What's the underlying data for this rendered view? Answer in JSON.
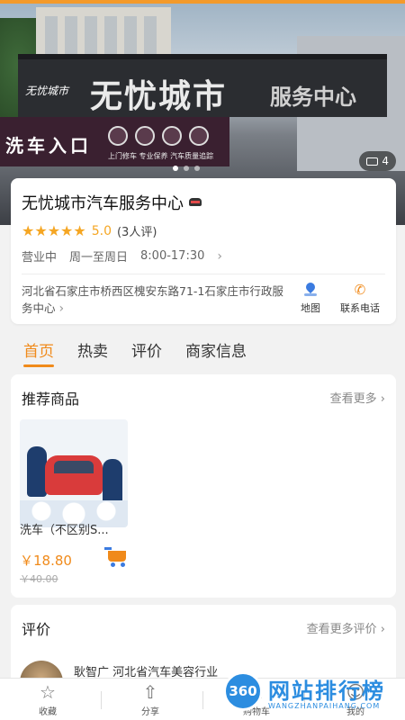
{
  "hero": {
    "sign_main": "无忧城市",
    "sign_sub": "服务中心",
    "sign_logo": "无忧城市",
    "entrance": "洗车入口",
    "slogan": "上门修车 专业保养 汽车质量追踪",
    "photo_count": "4"
  },
  "store": {
    "name": "无忧城市汽车服务中心",
    "stars": "★★★★★",
    "score": "5.0",
    "reviews": "(3人评)",
    "status": "营业中",
    "days": "周一至周日",
    "hours": "8:00-17:30",
    "address": "河北省石家庄市桥西区槐安东路71-1石家庄市行政服务中心",
    "map_label": "地图",
    "phone_label": "联系电话"
  },
  "tabs": [
    "首页",
    "热卖",
    "评价",
    "商家信息"
  ],
  "recommend": {
    "title": "推荐商品",
    "see_more": "查看更多",
    "product": {
      "name": "洗车（不区别S...",
      "price": "￥18.80",
      "original_price": "￥40.00"
    }
  },
  "review_section": {
    "title": "评价",
    "see_more": "查看更多评价",
    "first_review_user": "耿智广  河北省汽车美容行业"
  },
  "bottom_bar": {
    "favorite": "收藏",
    "share": "分享",
    "cart": "购物车",
    "mine": "我的"
  },
  "watermark": {
    "badge": "360",
    "text": "网站排行榜",
    "sub": "WANGZHANPAIHANG.COM"
  },
  "colors": {
    "accent": "#f08a1a",
    "star": "#f5a623",
    "map_icon": "#3b7be0",
    "top_bar": "#f39a2b"
  }
}
